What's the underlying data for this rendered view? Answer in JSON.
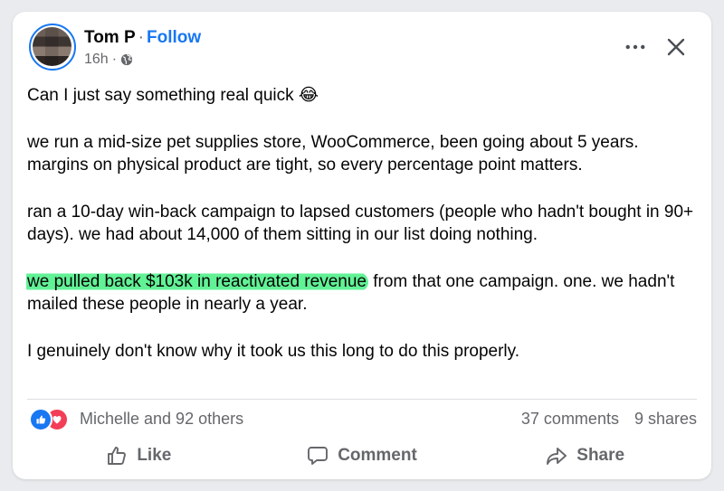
{
  "post": {
    "author": "Tom P",
    "separator": "·",
    "follow_label": "Follow",
    "time": "16h",
    "time_separator": "·",
    "audience_icon": "globe-icon",
    "paragraphs": {
      "p1": "Can I just say something real quick 😂",
      "p2": "we run a mid-size pet supplies store, WooCommerce, been going about 5 years. margins on physical product are tight, so every percentage point matters.",
      "p3": "ran a 10-day win-back campaign to lapsed customers (people who hadn't bought in 90+ days). we had about 14,000 of them sitting in our list doing nothing.",
      "p4_highlight": "we pulled back $103k in reactivated revenue",
      "p4_rest": " from that one campaign. one. we hadn't mailed these people in nearly a year.",
      "p5": "I genuinely don't know why it took us this long to do this properly."
    }
  },
  "engagement": {
    "reactions_text": "Michelle and 92 others",
    "reaction_icons": [
      "like-icon",
      "love-icon"
    ],
    "comments": "37 comments",
    "shares": "9 shares"
  },
  "actions": {
    "like": "Like",
    "comment": "Comment",
    "share": "Share"
  },
  "colors": {
    "accent": "#1877f2",
    "love": "#f33e58",
    "highlight": "#62f296",
    "muted_text": "#65676b"
  }
}
